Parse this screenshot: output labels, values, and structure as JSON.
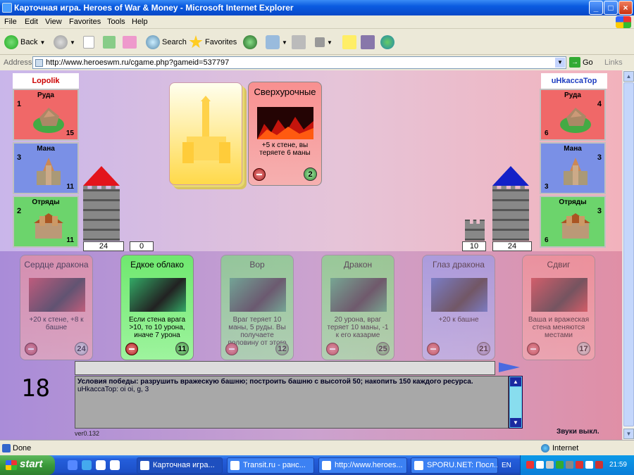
{
  "window": {
    "title": "Карточная игра. Heroes of War & Money - Microsoft Internet Explorer"
  },
  "menu": [
    "File",
    "Edit",
    "View",
    "Favorites",
    "Tools",
    "Help"
  ],
  "toolbar": {
    "back": "Back",
    "search": "Search",
    "favorites": "Favorites"
  },
  "address": {
    "label": "Address",
    "url": "http://www.heroeswm.ru/cgame.php?gameid=537797",
    "go": "Go",
    "links": "Links"
  },
  "game": {
    "left_player": {
      "name": "Lopolik",
      "resources": [
        {
          "label": "Руда",
          "prod": "1",
          "amount": "15"
        },
        {
          "label": "Мана",
          "prod": "3",
          "amount": "11"
        },
        {
          "label": "Отряды",
          "prod": "2",
          "amount": "11"
        }
      ],
      "tower": "24",
      "wall": "0"
    },
    "right_player": {
      "name": "uHkaccaTop",
      "resources": [
        {
          "label": "Руда",
          "prod": "4",
          "amount": "6"
        },
        {
          "label": "Мана",
          "prod": "3",
          "amount": "3"
        },
        {
          "label": "Отряды",
          "prod": "3",
          "amount": "6"
        }
      ],
      "tower": "24",
      "wall": "10"
    },
    "played_card": {
      "name": "Сверхурочные",
      "desc": "+5 к стене, вы теряете 6 маны",
      "cost": "2"
    },
    "hand": [
      {
        "name": "Сердце дракона",
        "desc": "+20 к стене, +8 к башне",
        "cost": "24",
        "type": "red",
        "dim": true
      },
      {
        "name": "Едкое облако",
        "desc": "Если стена врага >10, то 10 урона, иначе 7 урона",
        "cost": "11",
        "type": "green",
        "dim": false
      },
      {
        "name": "Вор",
        "desc": "Враг теряет 10 маны, 5 руды. Вы получаете половину от этого",
        "cost": "12",
        "type": "green",
        "dim": true
      },
      {
        "name": "Дракон",
        "desc": "20 урона, враг теряет 10 маны, -1 к его казарме",
        "cost": "25",
        "type": "green",
        "dim": true
      },
      {
        "name": "Глаз дракона",
        "desc": "+20 к башне",
        "cost": "21",
        "type": "blue",
        "dim": true
      },
      {
        "name": "Сдвиг",
        "desc": "Ваша и вражеская стена меняются местами",
        "cost": "17",
        "type": "red",
        "dim": true
      }
    ],
    "turn": "18",
    "log_lines": [
      "Условия победы: разрушить вражескую башню; построить башню с высотой 50; накопить 150 каждого ресурса.",
      "uHkaccaTop: oi oi, g, 3"
    ],
    "version": "ver0.132",
    "sound": "Звуки выкл."
  },
  "status": {
    "text": "Done",
    "zone": "Internet"
  },
  "taskbar": {
    "start": "start",
    "tasks": [
      "Карточная игра...",
      "Transit.ru - ранс...",
      "http://www.heroes...",
      "SPORU.NET: Посл..."
    ],
    "lang": "EN",
    "clock": "21:59"
  }
}
